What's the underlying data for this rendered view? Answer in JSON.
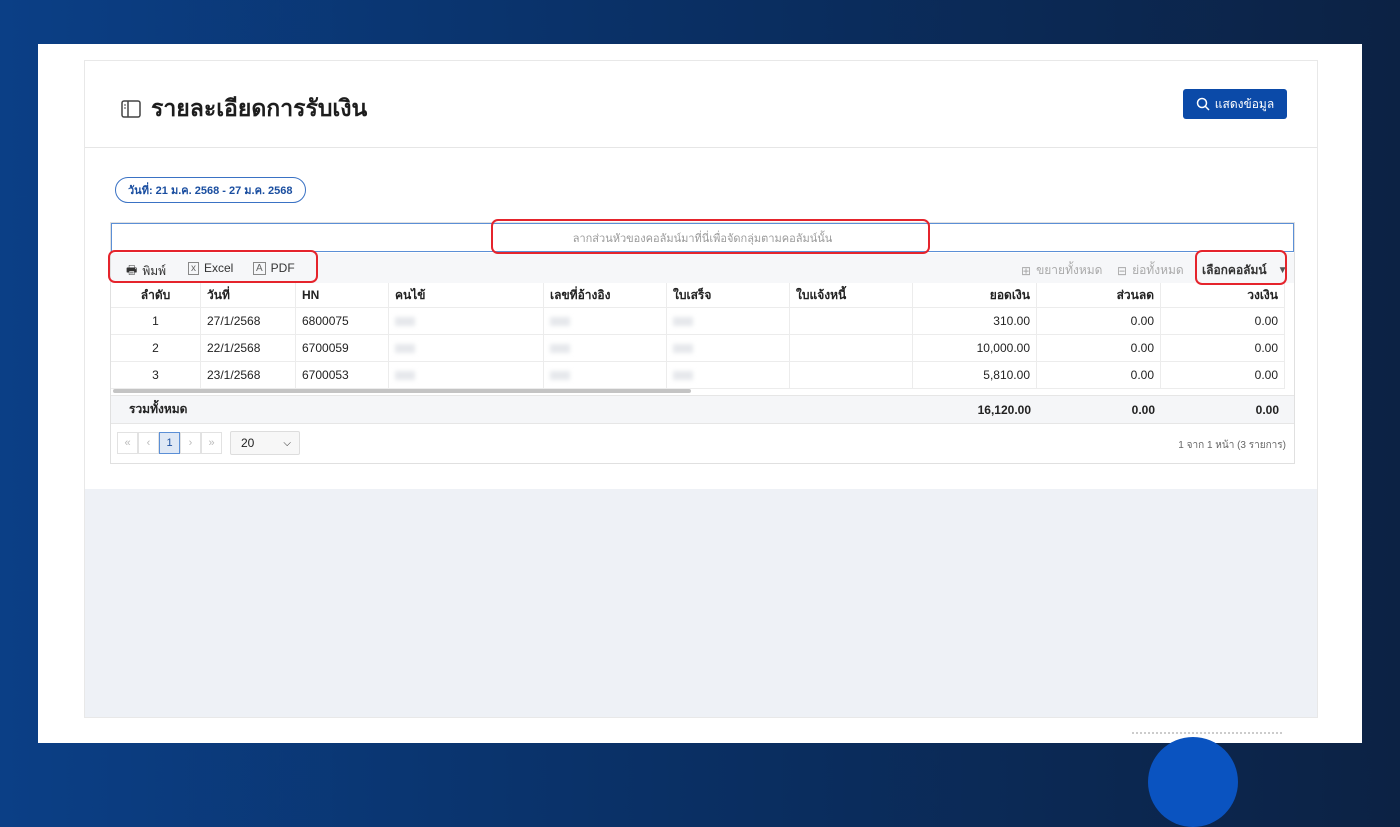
{
  "header": {
    "title": "รายละเอียดการรับเงิน",
    "show_button": "แสดงข้อมูล"
  },
  "filter": {
    "date_range": "วันที่: 21 ม.ค. 2568 - 27 ม.ค. 2568"
  },
  "grid": {
    "group_panel_hint": "ลากส่วนหัวของคอลัมน์มาที่นี่เพื่อจัดกลุ่มตามคอลัมน์นั้น",
    "toolbar": {
      "print": "พิมพ์",
      "excel": "Excel",
      "pdf": "PDF",
      "expand_all": "ขยายทั้งหมด",
      "collapse_all": "ย่อทั้งหมด",
      "column_chooser": "เลือกคอลัมน์"
    },
    "columns": [
      "ลำดับ",
      "วันที่",
      "HN",
      "คนไข้",
      "เลขที่อ้างอิง",
      "ใบเสร็จ",
      "ใบแจ้งหนี้",
      "ยอดเงิน",
      "ส่วนลด",
      "วงเงิน"
    ],
    "rows": [
      {
        "no": "1",
        "date": "27/1/2568",
        "hn": "6800075",
        "amount": "310.00",
        "discount": "0.00",
        "limit": "0.00"
      },
      {
        "no": "2",
        "date": "22/1/2568",
        "hn": "6700059",
        "amount": "10,000.00",
        "discount": "0.00",
        "limit": "0.00"
      },
      {
        "no": "3",
        "date": "23/1/2568",
        "hn": "6700053",
        "amount": "5,810.00",
        "discount": "0.00",
        "limit": "0.00"
      }
    ],
    "total": {
      "label": "รวมทั้งหมด",
      "amount": "16,120.00",
      "discount": "0.00",
      "limit": "0.00"
    },
    "pager": {
      "first": "«",
      "prev": "‹",
      "current": "1",
      "next": "›",
      "last": "»",
      "page_size": "20",
      "info": "1 จาก 1 หน้า (3 รายการ)"
    }
  },
  "colors": {
    "primary": "#0b4aa8",
    "annotation": "#e5242c"
  }
}
